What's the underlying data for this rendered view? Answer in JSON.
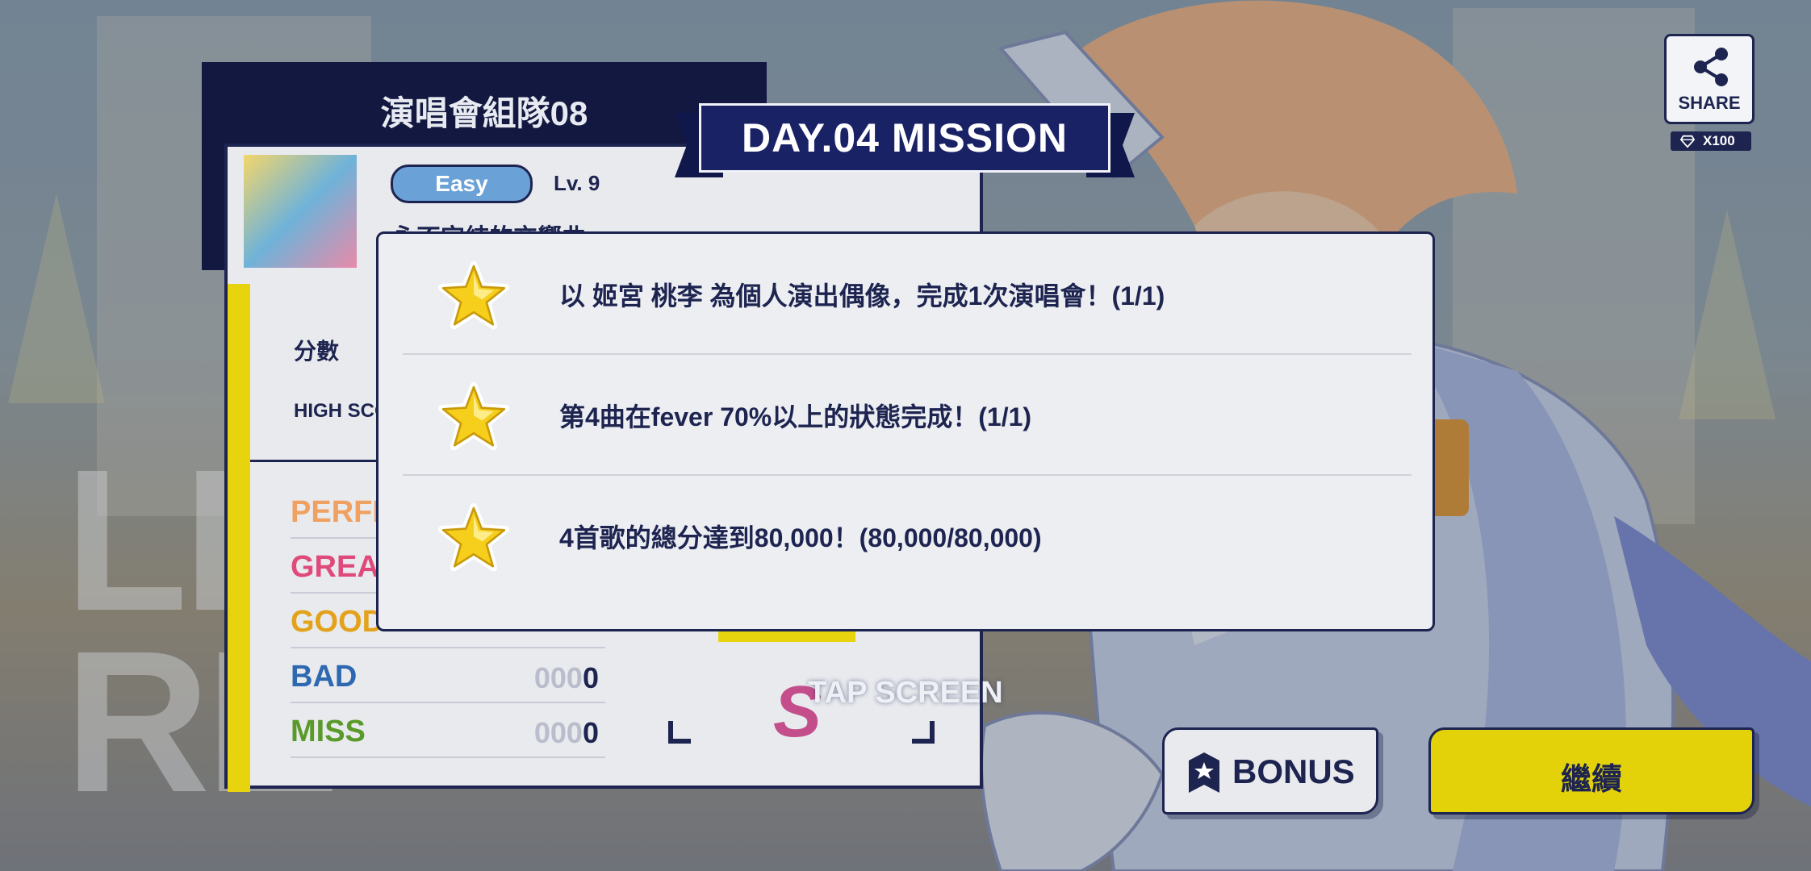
{
  "result_card": {
    "unit_title": "演唱會組隊08",
    "difficulty": "Easy",
    "level": "Lv. 9",
    "song_title": "永不完結的交響曲",
    "score_label": "分數",
    "high_score_label": "HIGH SCORE",
    "judgements": [
      {
        "label": "PERFECT",
        "value_dim": "",
        "value": "",
        "color": "#f0a060"
      },
      {
        "label": "GREAT",
        "value_dim": "",
        "value": "",
        "color": "#e04a7a"
      },
      {
        "label": "GOOD",
        "value_dim": "",
        "value": "",
        "color": "#e3a21a"
      },
      {
        "label": "BAD",
        "value_dim": "000",
        "value": "0",
        "color": "#2d68b0"
      },
      {
        "label": "MISS",
        "value_dim": "000",
        "value": "0",
        "color": "#5a9a2a"
      }
    ],
    "rank": "S",
    "background_text_line1": "LI",
    "background_text_line2": "RE"
  },
  "mission": {
    "banner": "DAY.04 MISSION",
    "items": [
      {
        "text": "以 姬宮 桃李 為個人演出偶像，完成1次演唱會！(1/1)",
        "icon": "star-icon"
      },
      {
        "text": "第4曲在fever 70%以上的狀態完成！(1/1)",
        "icon": "star-icon"
      },
      {
        "text": "4首歌的總分達到80,000！(80,000/80,000)",
        "icon": "star-icon"
      }
    ]
  },
  "tap_screen": "TAP SCREEN",
  "share": {
    "label": "SHARE",
    "reward": "X100",
    "icon": "share-icon",
    "reward_icon": "diamond-icon"
  },
  "buttons": {
    "bonus": "BONUS",
    "continue": "繼續"
  },
  "colors": {
    "navy": "#1d2450",
    "accent_yellow": "#e3d10a",
    "ribbon": "#1a2266"
  }
}
